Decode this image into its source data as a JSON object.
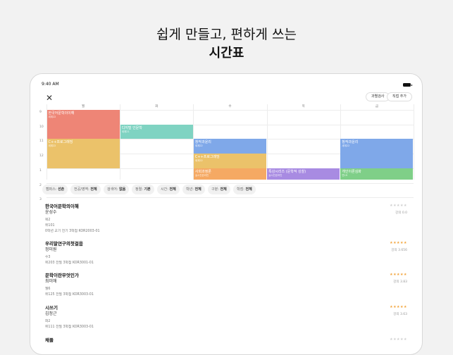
{
  "headline": {
    "line1": "쉽게 만들고, 편하게 쓰는",
    "line2": "시간표"
  },
  "status_bar": {
    "time": "9:40 AM"
  },
  "toolbar": {
    "filter_label": "과별검사",
    "add_label": "직접 추가"
  },
  "timetable": {
    "days": [
      "월",
      "화",
      "수",
      "목",
      "금"
    ],
    "hours": [
      "9",
      "10",
      "11",
      "12",
      "1",
      "2",
      "3"
    ],
    "courses": [
      {
        "name": "한국어문학의이해",
        "room": "새계22",
        "day": 0,
        "start": 9.0,
        "end": 11.0,
        "color": "#ee8576"
      },
      {
        "name": "C++프로그래밍",
        "room": "새계22",
        "day": 0,
        "start": 11.0,
        "end": 13.0,
        "color": "#ebc26a"
      },
      {
        "name": "디지털 인문학",
        "room": "새계21",
        "day": 1,
        "start": 10.0,
        "end": 11.0,
        "color": "#7fd3c2"
      },
      {
        "name": "창작과윤리",
        "room": "새계22",
        "day": 2,
        "start": 11.0,
        "end": 12.0,
        "color": "#7fa8e9"
      },
      {
        "name": "C++프로그래밍",
        "room": "새계22",
        "day": 2,
        "start": 12.0,
        "end": 13.0,
        "color": "#ebc26a"
      },
      {
        "name": "사회과정론",
        "room": "실시간온라인",
        "day": 2,
        "start": 13.0,
        "end": 13.8,
        "color": "#f5a963"
      },
      {
        "name": "특강시리즈 (문학적 성찰)",
        "room": "실시간온라인",
        "day": 3,
        "start": 13.0,
        "end": 13.8,
        "color": "#a88be2"
      },
      {
        "name": "창작과윤리",
        "room": "새계22",
        "day": 4,
        "start": 11.0,
        "end": 13.0,
        "color": "#7fa8e9"
      },
      {
        "name": "개인이론심화",
        "room": "연19",
        "day": 4,
        "start": 13.0,
        "end": 13.8,
        "color": "#7fcf88"
      }
    ]
  },
  "filters": [
    {
      "label": "캠퍼스:",
      "value": "선촌"
    },
    {
      "label": "전공/영역:",
      "value": "전체"
    },
    {
      "label": "검색어:",
      "value": "없음"
    },
    {
      "label": "정렬:",
      "value": "기본"
    },
    {
      "label": "시간:",
      "value": "전체"
    },
    {
      "label": "학년:",
      "value": "전체"
    },
    {
      "label": "구분:",
      "value": "전체"
    },
    {
      "label": "학점:",
      "value": "전체"
    }
  ],
  "courses_list": [
    {
      "title": "한국어문학의이해",
      "professor": "윤성수",
      "day": "목2",
      "room": "위101",
      "meta": "0학년  교기  전기  3학점  KOR2003-01",
      "stars": 0,
      "rating": "강의 0.0"
    },
    {
      "title": "우리말연구의첫걸음",
      "professor": "정미원",
      "day": "수3",
      "room": "위203  전필  3학점  KOR3001-01",
      "meta": "",
      "stars": 5,
      "rating": "강의 3.656"
    },
    {
      "title": "문학이란무엇인가",
      "professor": "최미애",
      "day": "월6",
      "room": "위125  전필  3학점  KOR3003-01",
      "meta": "",
      "stars": 5,
      "rating": "강의 3.83"
    },
    {
      "title": "시쓰기",
      "professor": "김정근",
      "day": "화2",
      "room": "위111  전필  3학점  KOR3003-01",
      "meta": "",
      "stars": 5,
      "rating": "강의 3.63"
    },
    {
      "title": "채플",
      "professor": "",
      "day": "",
      "room": "",
      "meta": "",
      "stars": 0,
      "rating": ""
    }
  ]
}
